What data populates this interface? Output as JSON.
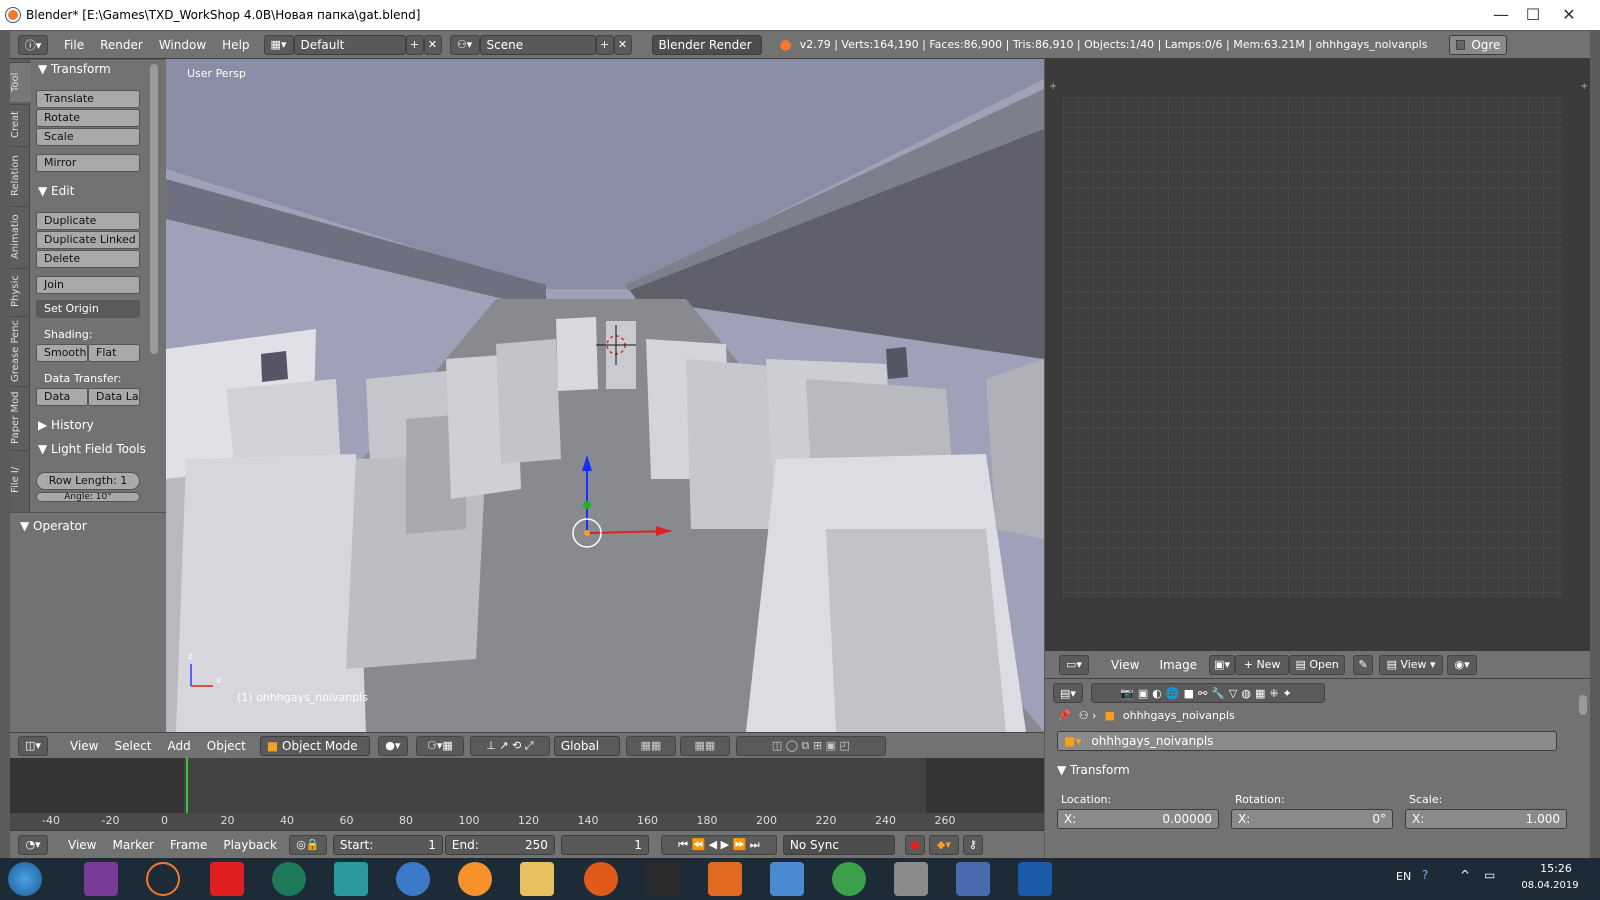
{
  "window": {
    "title": "Blender* [E:\\Games\\TXD_WorkShop 4.0B\\Новая папка\\gat.blend]",
    "minimize": "—",
    "maximize": "☐",
    "close": "✕"
  },
  "info_header": {
    "menus": [
      "File",
      "Render",
      "Window",
      "Help"
    ],
    "screen_layout": "Default",
    "scene": "Scene",
    "engine": "Blender Render",
    "stats": "v2.79 | Verts:164,190 | Faces:86,900 | Tris:86,910 | Objects:1/40 | Lamps:0/6 | Mem:63.21M | ohhhgays_noivanpls",
    "ogre_label": "Ogre"
  },
  "tool_tabs": [
    "Tool",
    "Creat",
    "Relation",
    "Animatio",
    "Physic",
    "Grease Penc",
    "Paper Mod",
    "File I/"
  ],
  "tool_shelf": {
    "transform_title": "Transform",
    "translate": "Translate",
    "rotate": "Rotate",
    "scale": "Scale",
    "mirror": "Mirror",
    "edit_title": "Edit",
    "duplicate": "Duplicate",
    "duplicate_linked": "Duplicate Linked",
    "delete": "Delete",
    "join": "Join",
    "set_origin": "Set Origin",
    "shading_label": "Shading:",
    "smooth": "Smooth",
    "flat": "Flat",
    "data_transfer_label": "Data Transfer:",
    "data": "Data",
    "data_la": "Data La",
    "history_title": "History",
    "lightfield_title": "Light Field Tools",
    "row_length": "Row Length: 1",
    "angle": "Angle: 10°"
  },
  "operator": {
    "title": "Operator"
  },
  "viewport": {
    "view_label": "User Persp",
    "object_label": "(1) ohhhgays_noivanpls",
    "axis_z": "z",
    "axis_x": "x"
  },
  "viewport_header": {
    "menus": [
      "View",
      "Select",
      "Add",
      "Object"
    ],
    "mode": "Object Mode",
    "orientation": "Global"
  },
  "timeline": {
    "ticks": [
      "-40",
      "-20",
      "0",
      "20",
      "40",
      "60",
      "80",
      "100",
      "120",
      "140",
      "160",
      "180",
      "200",
      "220",
      "240",
      "260"
    ],
    "current_frame_marker": 0
  },
  "timeline_header": {
    "menus": [
      "View",
      "Marker",
      "Frame",
      "Playback"
    ],
    "start_label": "Start:",
    "start_value": "1",
    "end_label": "End:",
    "end_value": "250",
    "current": "1",
    "sync": "No Sync"
  },
  "image_header": {
    "menus": [
      "View",
      "Image"
    ],
    "new_label": "New",
    "open_label": "Open",
    "view_label": "View"
  },
  "properties": {
    "object_name": "ohhhgays_noivanpls",
    "object_field": "ohhhgays_noivanpls",
    "transform_title": "Transform",
    "location_label": "Location:",
    "rotation_label": "Rotation:",
    "scale_label": "Scale:",
    "loc_x": "0.00000",
    "rot_x": "0°",
    "scale_x": "1.000",
    "x_label": "X:"
  },
  "taskbar": {
    "lang": "EN",
    "time": "15:26",
    "date": "08.04.2019"
  },
  "colors": {
    "panel": "#727272",
    "viewport_sky": "#9c9fb8",
    "floor": "#8d8d94",
    "accent_orange": "#f5792a"
  }
}
